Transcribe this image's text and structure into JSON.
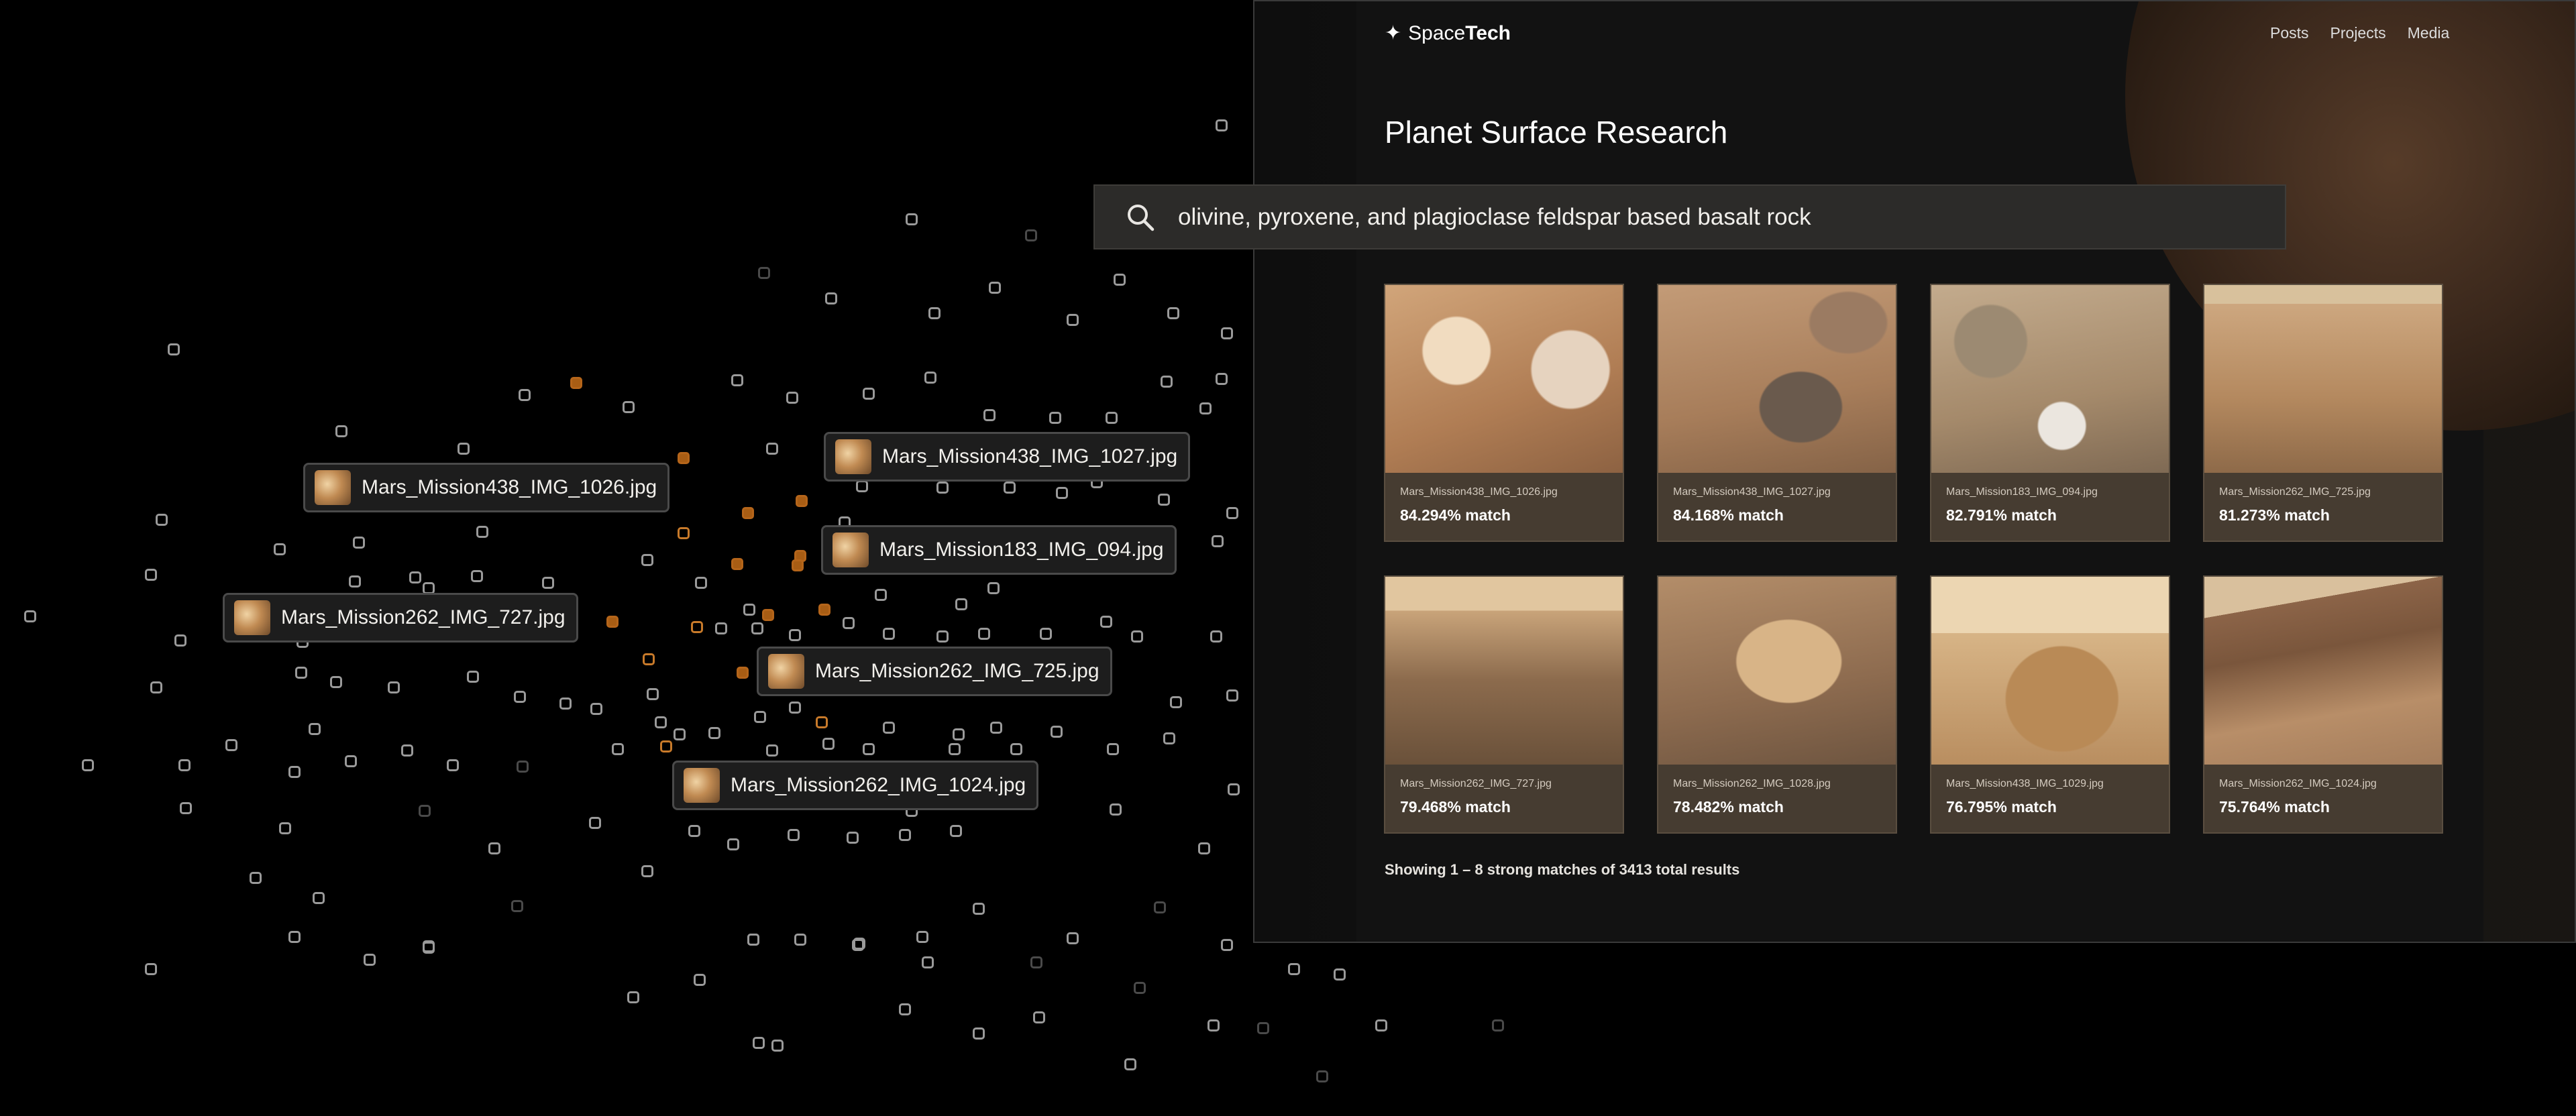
{
  "header": {
    "brand_prefix": "Space",
    "brand_bold": "Tech",
    "nav": [
      "Posts",
      "Projects",
      "Media"
    ]
  },
  "page_title": "Planet Surface Research",
  "search": {
    "query": "olivine, pyroxene, and plagioclase feldspar based basalt rock"
  },
  "results": [
    {
      "filename": "Mars_Mission438_IMG_1026.jpg",
      "match": "84.294% match"
    },
    {
      "filename": "Mars_Mission438_IMG_1027.jpg",
      "match": "84.168% match"
    },
    {
      "filename": "Mars_Mission183_IMG_094.jpg",
      "match": "82.791% match"
    },
    {
      "filename": "Mars_Mission262_IMG_725.jpg",
      "match": "81.273% match"
    },
    {
      "filename": "Mars_Mission262_IMG_727.jpg",
      "match": "79.468% match"
    },
    {
      "filename": "Mars_Mission262_IMG_1028.jpg",
      "match": "78.482% match"
    },
    {
      "filename": "Mars_Mission438_IMG_1029.jpg",
      "match": "76.795% match"
    },
    {
      "filename": "Mars_Mission262_IMG_1024.jpg",
      "match": "75.764% match"
    }
  ],
  "summary": "Showing 1 – 8 strong matches of 3413 total results",
  "scatter_labels": [
    "Mars_Mission438_IMG_1026.jpg",
    "Mars_Mission438_IMG_1027.jpg",
    "Mars_Mission183_IMG_094.jpg",
    "Mars_Mission262_IMG_727.jpg",
    "Mars_Mission262_IMG_725.jpg",
    "Mars_Mission262_IMG_1024.jpg"
  ],
  "colors": {
    "accent": "#a85d14",
    "card": "#463c31",
    "background": "#000000"
  }
}
